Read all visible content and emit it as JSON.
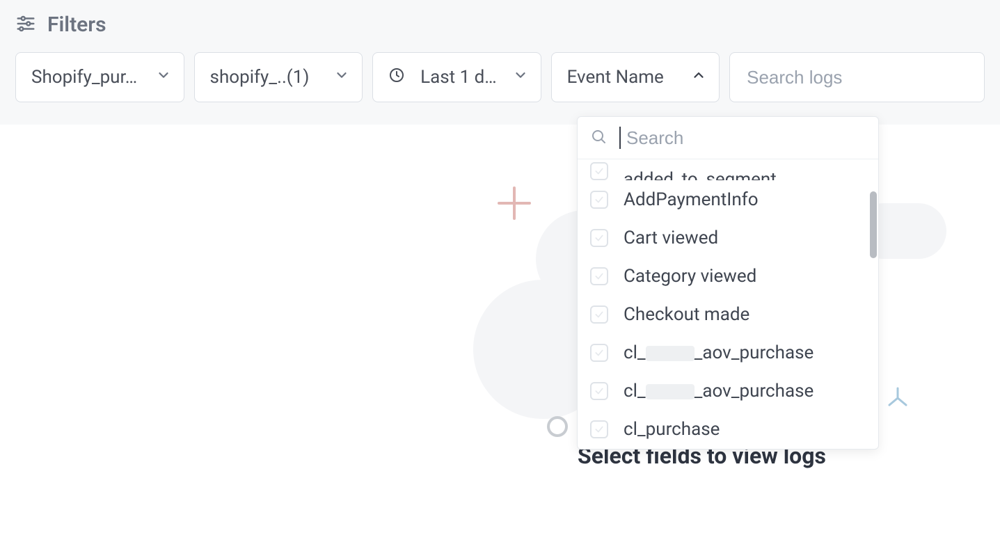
{
  "filters": {
    "title": "Filters",
    "source_select": {
      "label": "Shopify_pur…"
    },
    "account_select": {
      "label": "shopify_..(1)"
    },
    "time_select": {
      "label": "Last 1 d…"
    },
    "event_select": {
      "label": "Event Name"
    },
    "search_placeholder": "Search logs"
  },
  "event_dropdown": {
    "search_placeholder": "Search",
    "options_cut_top": "added_to_segment",
    "options": [
      "AddPaymentInfo",
      "Cart viewed",
      "Category viewed",
      "Checkout made",
      "cl_​REDACT​_aov_purchase",
      "cl_​REDACT​_aov_purchase",
      "cl_purchase"
    ]
  },
  "empty_state": {
    "message": "Select fields to view logs"
  }
}
